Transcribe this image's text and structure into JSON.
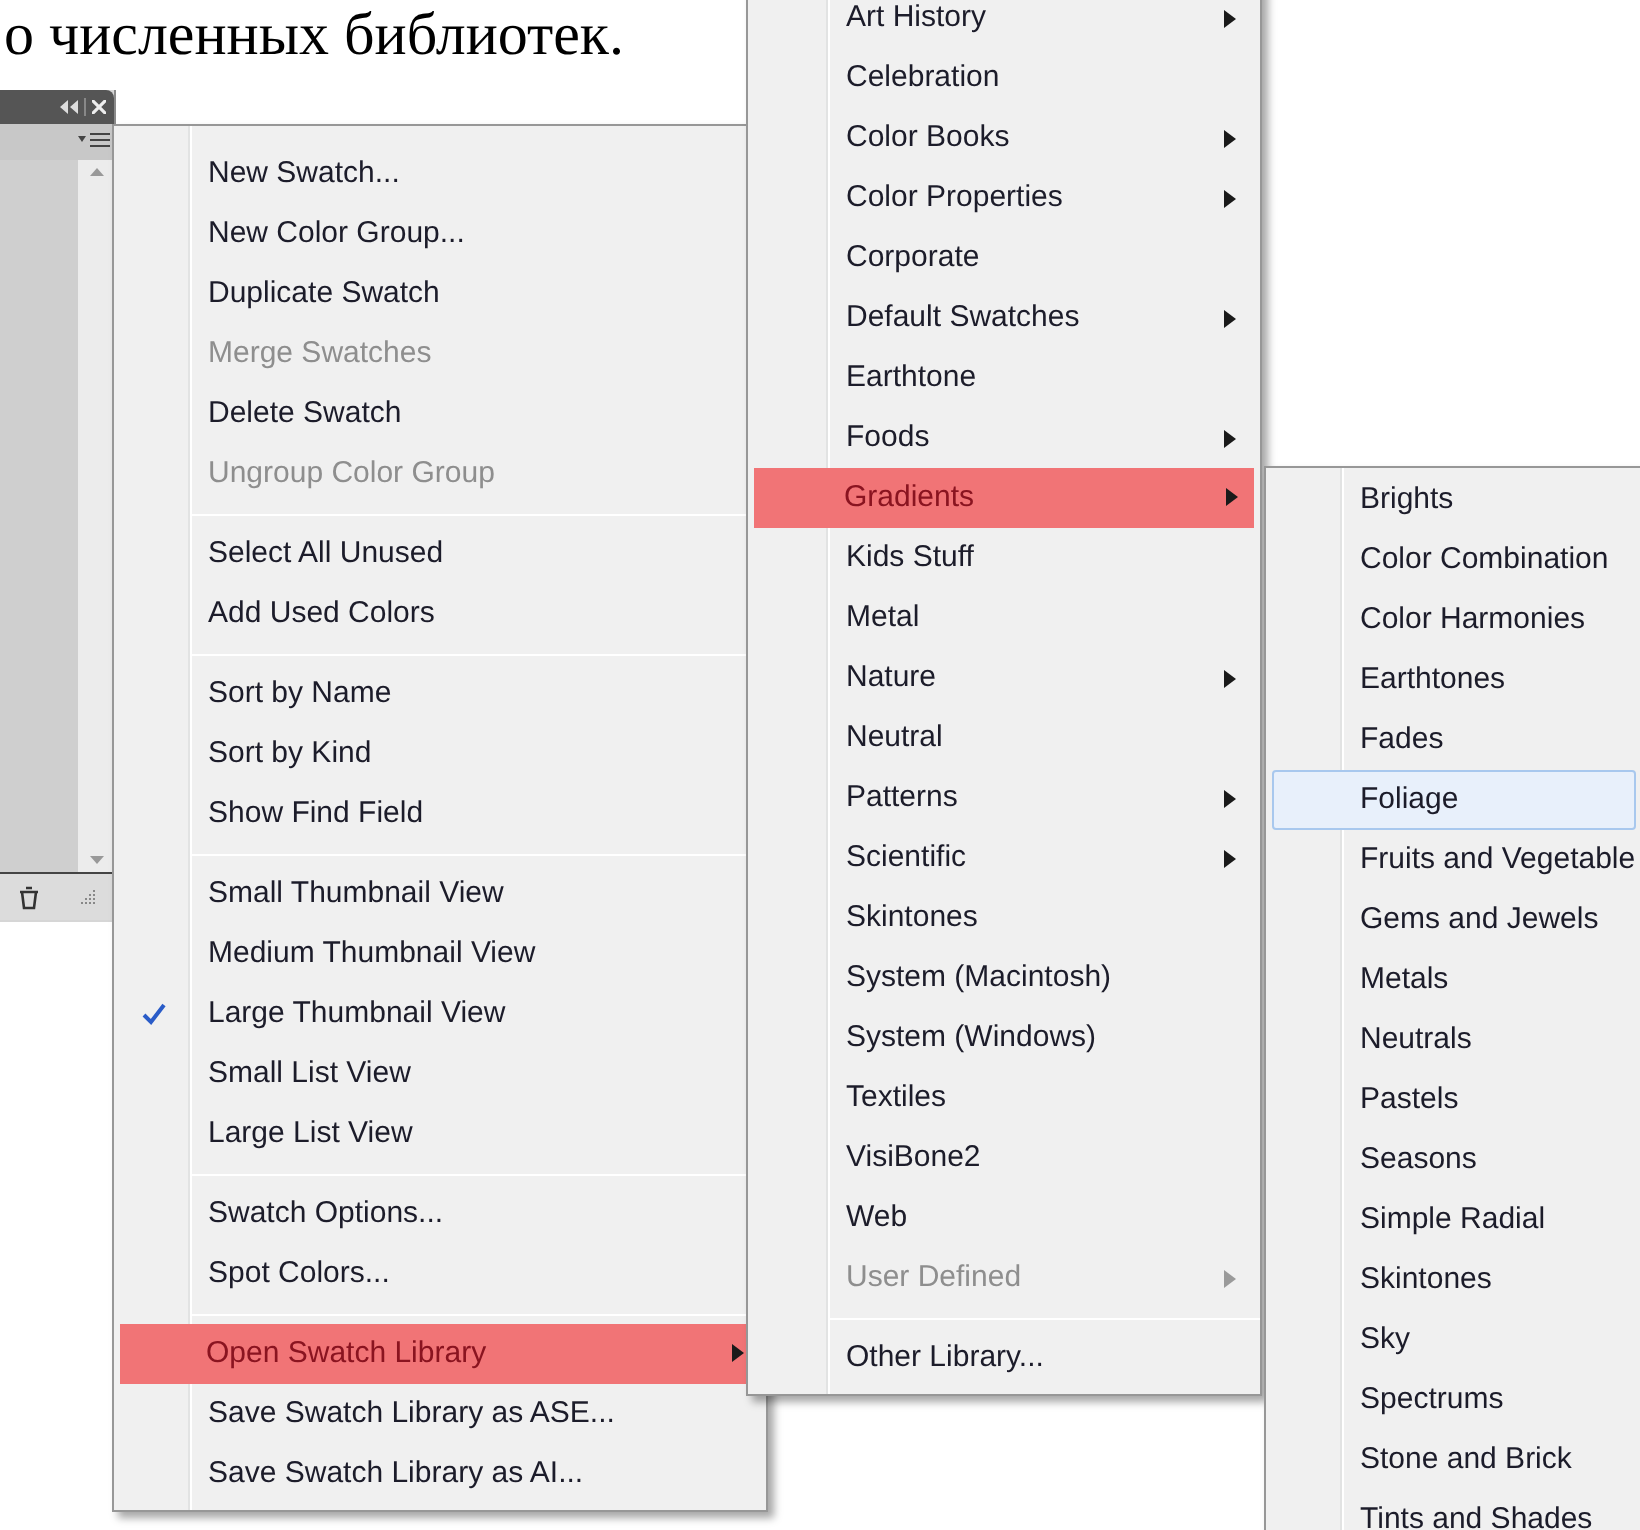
{
  "heading": "о численных библиотек.",
  "menus": [
    {
      "kind": "cascade",
      "items": [
        {
          "kind": "item",
          "label": "New Swatch...",
          "disabled": false,
          "checked": false,
          "submenu": false,
          "selected": false
        },
        {
          "kind": "item",
          "label": "New Color Group...",
          "disabled": false,
          "checked": false,
          "submenu": false,
          "selected": false
        },
        {
          "kind": "item",
          "label": "Duplicate Swatch",
          "disabled": false,
          "checked": false,
          "submenu": false,
          "selected": false
        },
        {
          "kind": "item",
          "label": "Merge Swatches",
          "disabled": true,
          "checked": false,
          "submenu": false,
          "selected": false
        },
        {
          "kind": "item",
          "label": "Delete Swatch",
          "disabled": false,
          "checked": false,
          "submenu": false,
          "selected": false
        },
        {
          "kind": "item",
          "label": "Ungroup Color Group",
          "disabled": true,
          "checked": false,
          "submenu": false,
          "selected": false
        },
        {
          "kind": "separator"
        },
        {
          "kind": "item",
          "label": "Select All Unused",
          "disabled": false,
          "checked": false,
          "submenu": false,
          "selected": false
        },
        {
          "kind": "item",
          "label": "Add Used Colors",
          "disabled": false,
          "checked": false,
          "submenu": false,
          "selected": false
        },
        {
          "kind": "separator"
        },
        {
          "kind": "item",
          "label": "Sort by Name",
          "disabled": false,
          "checked": false,
          "submenu": false,
          "selected": false
        },
        {
          "kind": "item",
          "label": "Sort by Kind",
          "disabled": false,
          "checked": false,
          "submenu": false,
          "selected": false
        },
        {
          "kind": "item",
          "label": "Show Find Field",
          "disabled": false,
          "checked": false,
          "submenu": false,
          "selected": false
        },
        {
          "kind": "separator"
        },
        {
          "kind": "item",
          "label": "Small Thumbnail View",
          "disabled": false,
          "checked": false,
          "submenu": false,
          "selected": false
        },
        {
          "kind": "item",
          "label": "Medium Thumbnail View",
          "disabled": false,
          "checked": false,
          "submenu": false,
          "selected": false
        },
        {
          "kind": "item",
          "label": "Large Thumbnail View",
          "disabled": false,
          "checked": true,
          "submenu": false,
          "selected": false
        },
        {
          "kind": "item",
          "label": "Small List View",
          "disabled": false,
          "checked": false,
          "submenu": false,
          "selected": false
        },
        {
          "kind": "item",
          "label": "Large List View",
          "disabled": false,
          "checked": false,
          "submenu": false,
          "selected": false
        },
        {
          "kind": "separator"
        },
        {
          "kind": "item",
          "label": "Swatch Options...",
          "disabled": false,
          "checked": false,
          "submenu": false,
          "selected": false
        },
        {
          "kind": "item",
          "label": "Spot Colors...",
          "disabled": false,
          "checked": false,
          "submenu": false,
          "selected": false
        },
        {
          "kind": "separator"
        },
        {
          "kind": "item",
          "label": "Open Swatch Library",
          "disabled": false,
          "checked": false,
          "submenu": true,
          "selected": true
        },
        {
          "kind": "item",
          "label": "Save Swatch Library as ASE...",
          "disabled": false,
          "checked": false,
          "submenu": false,
          "selected": false
        },
        {
          "kind": "item",
          "label": "Save Swatch Library as AI...",
          "disabled": false,
          "checked": false,
          "submenu": false,
          "selected": false
        }
      ]
    },
    {
      "kind": "cascade",
      "items": [
        {
          "kind": "item",
          "label": "Art History",
          "disabled": false,
          "checked": false,
          "submenu": true,
          "selected": false
        },
        {
          "kind": "item",
          "label": "Celebration",
          "disabled": false,
          "checked": false,
          "submenu": false,
          "selected": false
        },
        {
          "kind": "item",
          "label": "Color Books",
          "disabled": false,
          "checked": false,
          "submenu": true,
          "selected": false
        },
        {
          "kind": "item",
          "label": "Color Properties",
          "disabled": false,
          "checked": false,
          "submenu": true,
          "selected": false
        },
        {
          "kind": "item",
          "label": "Corporate",
          "disabled": false,
          "checked": false,
          "submenu": false,
          "selected": false
        },
        {
          "kind": "item",
          "label": "Default Swatches",
          "disabled": false,
          "checked": false,
          "submenu": true,
          "selected": false
        },
        {
          "kind": "item",
          "label": "Earthtone",
          "disabled": false,
          "checked": false,
          "submenu": false,
          "selected": false
        },
        {
          "kind": "item",
          "label": "Foods",
          "disabled": false,
          "checked": false,
          "submenu": true,
          "selected": false
        },
        {
          "kind": "item",
          "label": "Gradients",
          "disabled": false,
          "checked": false,
          "submenu": true,
          "selected": true
        },
        {
          "kind": "item",
          "label": "Kids Stuff",
          "disabled": false,
          "checked": false,
          "submenu": false,
          "selected": false
        },
        {
          "kind": "item",
          "label": "Metal",
          "disabled": false,
          "checked": false,
          "submenu": false,
          "selected": false
        },
        {
          "kind": "item",
          "label": "Nature",
          "disabled": false,
          "checked": false,
          "submenu": true,
          "selected": false
        },
        {
          "kind": "item",
          "label": "Neutral",
          "disabled": false,
          "checked": false,
          "submenu": false,
          "selected": false
        },
        {
          "kind": "item",
          "label": "Patterns",
          "disabled": false,
          "checked": false,
          "submenu": true,
          "selected": false
        },
        {
          "kind": "item",
          "label": "Scientific",
          "disabled": false,
          "checked": false,
          "submenu": true,
          "selected": false
        },
        {
          "kind": "item",
          "label": "Skintones",
          "disabled": false,
          "checked": false,
          "submenu": false,
          "selected": false
        },
        {
          "kind": "item",
          "label": "System (Macintosh)",
          "disabled": false,
          "checked": false,
          "submenu": false,
          "selected": false
        },
        {
          "kind": "item",
          "label": "System (Windows)",
          "disabled": false,
          "checked": false,
          "submenu": false,
          "selected": false
        },
        {
          "kind": "item",
          "label": "Textiles",
          "disabled": false,
          "checked": false,
          "submenu": false,
          "selected": false
        },
        {
          "kind": "item",
          "label": "VisiBone2",
          "disabled": false,
          "checked": false,
          "submenu": false,
          "selected": false
        },
        {
          "kind": "item",
          "label": "Web",
          "disabled": false,
          "checked": false,
          "submenu": false,
          "selected": false
        },
        {
          "kind": "item",
          "label": "User Defined",
          "disabled": true,
          "checked": false,
          "submenu": true,
          "selected": false
        },
        {
          "kind": "separator"
        },
        {
          "kind": "item",
          "label": "Other Library...",
          "disabled": false,
          "checked": false,
          "submenu": false,
          "selected": false
        }
      ]
    },
    {
      "kind": "hover",
      "items": [
        {
          "kind": "item",
          "label": "Brights",
          "disabled": false,
          "checked": false,
          "submenu": false,
          "selected": false
        },
        {
          "kind": "item",
          "label": "Color Combination",
          "disabled": false,
          "checked": false,
          "submenu": false,
          "selected": false
        },
        {
          "kind": "item",
          "label": "Color Harmonies",
          "disabled": false,
          "checked": false,
          "submenu": false,
          "selected": false
        },
        {
          "kind": "item",
          "label": "Earthtones",
          "disabled": false,
          "checked": false,
          "submenu": false,
          "selected": false
        },
        {
          "kind": "item",
          "label": "Fades",
          "disabled": false,
          "checked": false,
          "submenu": false,
          "selected": false
        },
        {
          "kind": "item",
          "label": "Foliage",
          "disabled": false,
          "checked": false,
          "submenu": false,
          "selected": true
        },
        {
          "kind": "item",
          "label": "Fruits and Vegetable",
          "disabled": false,
          "checked": false,
          "submenu": false,
          "selected": false
        },
        {
          "kind": "item",
          "label": "Gems and Jewels",
          "disabled": false,
          "checked": false,
          "submenu": false,
          "selected": false
        },
        {
          "kind": "item",
          "label": "Metals",
          "disabled": false,
          "checked": false,
          "submenu": false,
          "selected": false
        },
        {
          "kind": "item",
          "label": "Neutrals",
          "disabled": false,
          "checked": false,
          "submenu": false,
          "selected": false
        },
        {
          "kind": "item",
          "label": "Pastels",
          "disabled": false,
          "checked": false,
          "submenu": false,
          "selected": false
        },
        {
          "kind": "item",
          "label": "Seasons",
          "disabled": false,
          "checked": false,
          "submenu": false,
          "selected": false
        },
        {
          "kind": "item",
          "label": "Simple Radial",
          "disabled": false,
          "checked": false,
          "submenu": false,
          "selected": false
        },
        {
          "kind": "item",
          "label": "Skintones",
          "disabled": false,
          "checked": false,
          "submenu": false,
          "selected": false
        },
        {
          "kind": "item",
          "label": "Sky",
          "disabled": false,
          "checked": false,
          "submenu": false,
          "selected": false
        },
        {
          "kind": "item",
          "label": "Spectrums",
          "disabled": false,
          "checked": false,
          "submenu": false,
          "selected": false
        },
        {
          "kind": "item",
          "label": "Stone and Brick",
          "disabled": false,
          "checked": false,
          "submenu": false,
          "selected": false
        },
        {
          "kind": "item",
          "label": "Tints and Shades",
          "disabled": false,
          "checked": false,
          "submenu": false,
          "selected": false
        }
      ]
    }
  ]
}
